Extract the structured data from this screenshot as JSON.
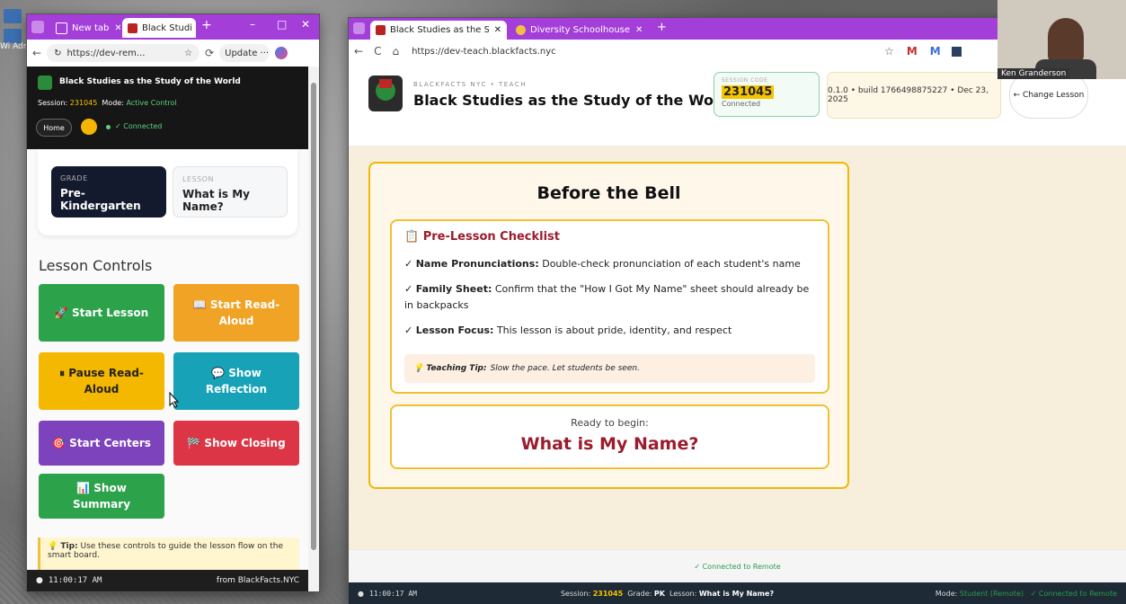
{
  "desktop": {
    "label": "Wi\nAdm"
  },
  "left_window": {
    "tabs": [
      {
        "label": "New tab",
        "active": false
      },
      {
        "label": "Black Studi",
        "active": true
      }
    ],
    "url": "https://dev-rem...",
    "update_label": "Update",
    "header": {
      "title": "Black Studies as the Study of the World",
      "session_label": "Session:",
      "session_code": "231045",
      "mode_label": "Mode:",
      "mode_value": "Active Control",
      "home_label": "Home",
      "connected_label": "✓ Connected"
    },
    "grade": {
      "label": "GRADE",
      "value": "Pre-Kindergarten"
    },
    "lesson": {
      "label": "LESSON",
      "value": "What is My Name?"
    },
    "lesson_controls_title": "Lesson Controls",
    "buttons": [
      {
        "label": "🚀 Start Lesson",
        "color": "#2ca24a"
      },
      {
        "label": "📖 Start Read-Aloud",
        "color": "#f0a324"
      },
      {
        "label": "⏸ Pause Read-Aloud",
        "color": "#f4b800"
      },
      {
        "label": "💬 Show Reflection",
        "color": "#17a2b8"
      },
      {
        "label": "🎯 Start Centers",
        "color": "#7c43bd"
      },
      {
        "label": "🏁 Show Closing",
        "color": "#dc3545"
      },
      {
        "label": "📊 Show Summary",
        "color": "#2ca24a"
      }
    ],
    "tip": {
      "prefix": "💡 Tip:",
      "text": "Use these controls to guide the lesson flow on the smart board."
    },
    "footer": {
      "time": "11:00:17 AM",
      "from": "from BlackFacts.NYC"
    }
  },
  "right_window": {
    "tabs": [
      {
        "label": "Black Studies as the Study of the",
        "active": true
      },
      {
        "label": "Diversity Schoolhouse",
        "active": false
      }
    ],
    "url": "https://dev-teach.blackfacts.nyc",
    "header": {
      "crumb": "BLACKFACTS NYC • TEACH",
      "title": "Black Studies as the Study of the World",
      "session_code_label": "SESSION CODE",
      "session_code": "231045",
      "session_status": "Connected",
      "build": "0.1.0 • build 1766498875227 • Dec 23, 2025",
      "change_lesson": "← Change Lesson"
    },
    "stage": {
      "title": "Before the Bell",
      "checklist_title": "📋 Pre-Lesson Checklist",
      "items": [
        {
          "check": "✓",
          "label": "Name Pronunciations:",
          "text": "Double-check pronunciation of each student's name"
        },
        {
          "check": "✓",
          "label": "Family Sheet:",
          "text": "Confirm that the \"How I Got My Name\" sheet should already be in backpacks"
        },
        {
          "check": "✓",
          "label": "Lesson Focus:",
          "text": "This lesson is about pride, identity, and respect"
        }
      ],
      "teaching_tip_label": "💡 Teaching Tip:",
      "teaching_tip": "Slow the pace. Let students be seen.",
      "ready_label": "Ready to begin:",
      "ready_lesson": "What is My Name?"
    },
    "connected_remote": "✓ Connected to Remote",
    "footer": {
      "time": "11:00:17 AM",
      "session_label": "Session:",
      "session_code": "231045",
      "grade_label": "Grade:",
      "grade": "PK",
      "lesson_label": "Lesson:",
      "lesson": "What is My Name?",
      "mode_label": "Mode:",
      "mode": "Student (Remote)",
      "status": "✓ Connected to Remote"
    }
  },
  "webcam": {
    "name": "Ken Granderson"
  }
}
